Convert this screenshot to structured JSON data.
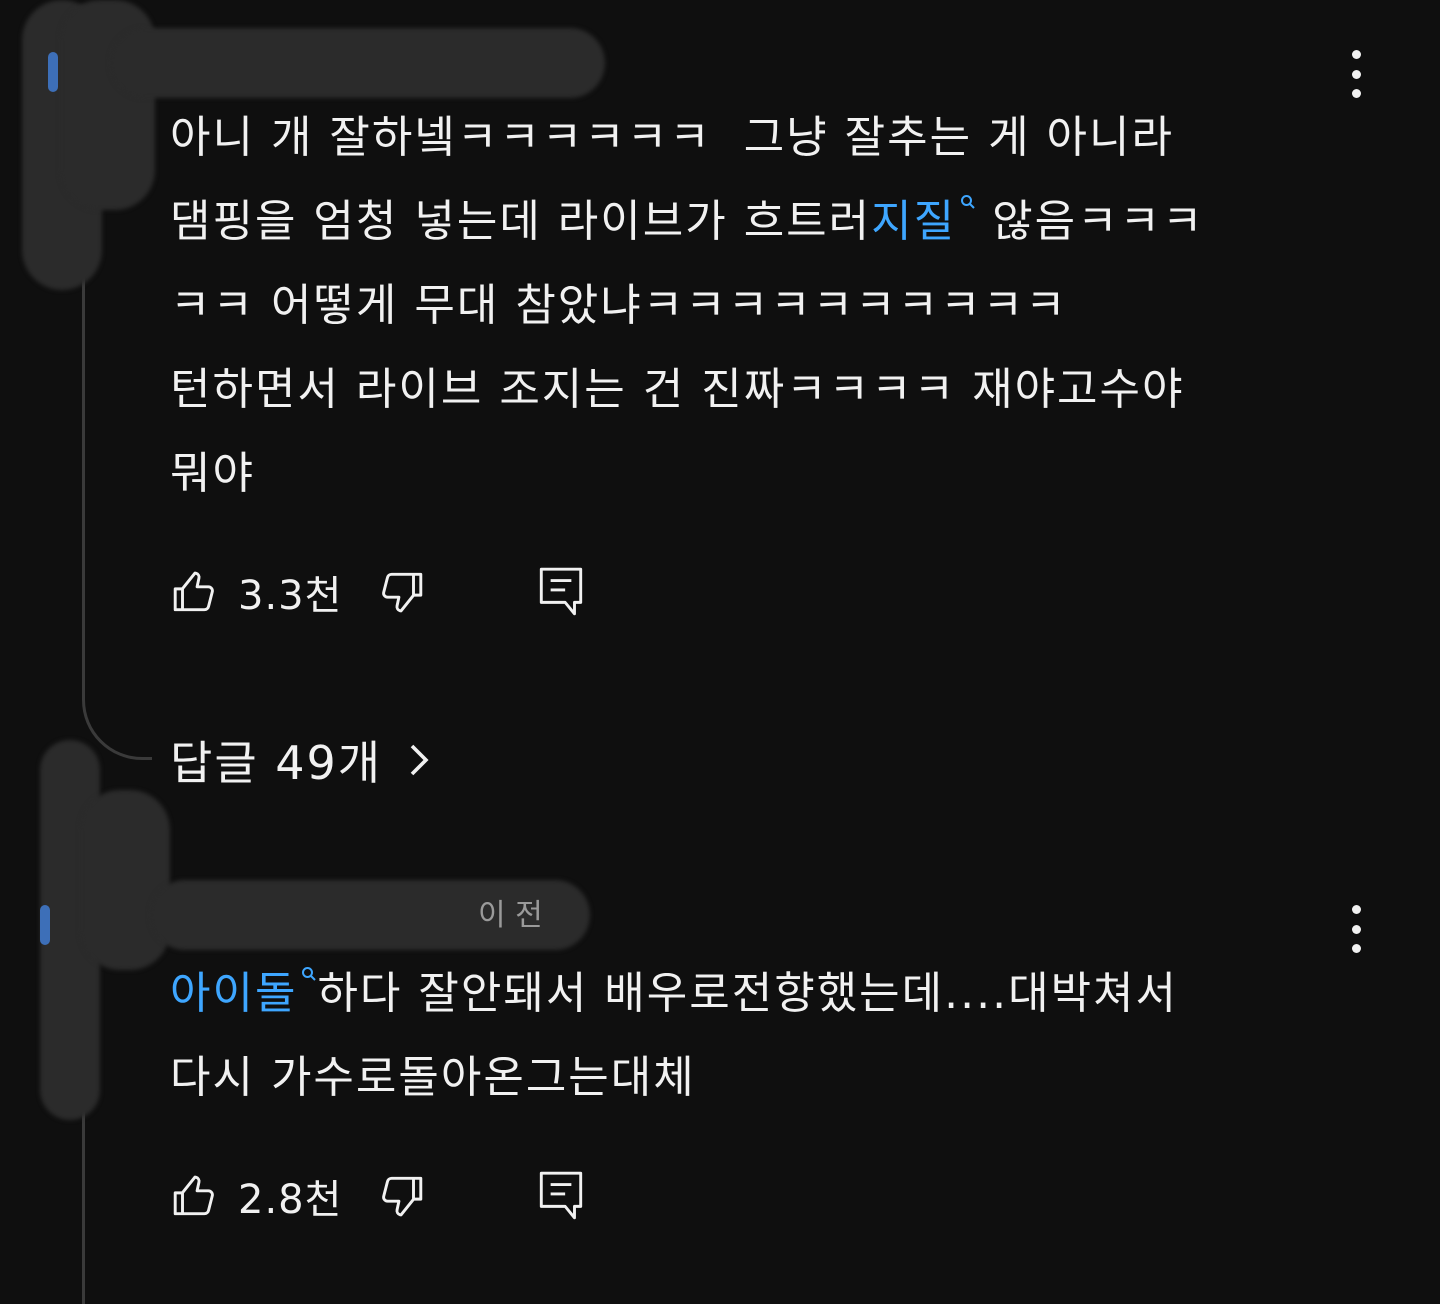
{
  "comments": [
    {
      "text_segments": [
        {
          "text": "아니 개 잘하넼ㅋㅋㅋㅋㅋㅋ  그냥 잘추는 게 아니라\n댐핑을 엄청 넣는데 라이브가 흐트러"
        },
        {
          "text": "지질",
          "link": true
        },
        {
          "text": " 않음ㅋㅋㅋ\nㅋㅋ 어떻게 무대 참았냐ㅋㅋㅋㅋㅋㅋㅋㅋㅋㅋ\n턴하면서 라이브 조지는 건 진짜ㅋㅋㅋㅋ 재야고수야\n뭐야"
        }
      ],
      "likes": "3.3천",
      "replies_label": "답글 49개"
    },
    {
      "meta_visible": "이 전",
      "text_segments": [
        {
          "text": "아이돌",
          "link": true
        },
        {
          "text": "하다 잘안돼서 배우로전향했는데....대박쳐서\n다시 가수로돌아온그는대체"
        }
      ],
      "likes": "2.8천"
    }
  ],
  "icons": {
    "like": "thumbs-up-icon",
    "dislike": "thumbs-down-icon",
    "reply": "comment-reply-icon",
    "more": "more-vert-icon",
    "chevron": "chevron-right-icon",
    "search": "search-link-icon"
  },
  "colors": {
    "background": "#0f0f0f",
    "text": "#f1f1f1",
    "link": "#3ea6ff",
    "thread_line": "#3a3a3a"
  }
}
